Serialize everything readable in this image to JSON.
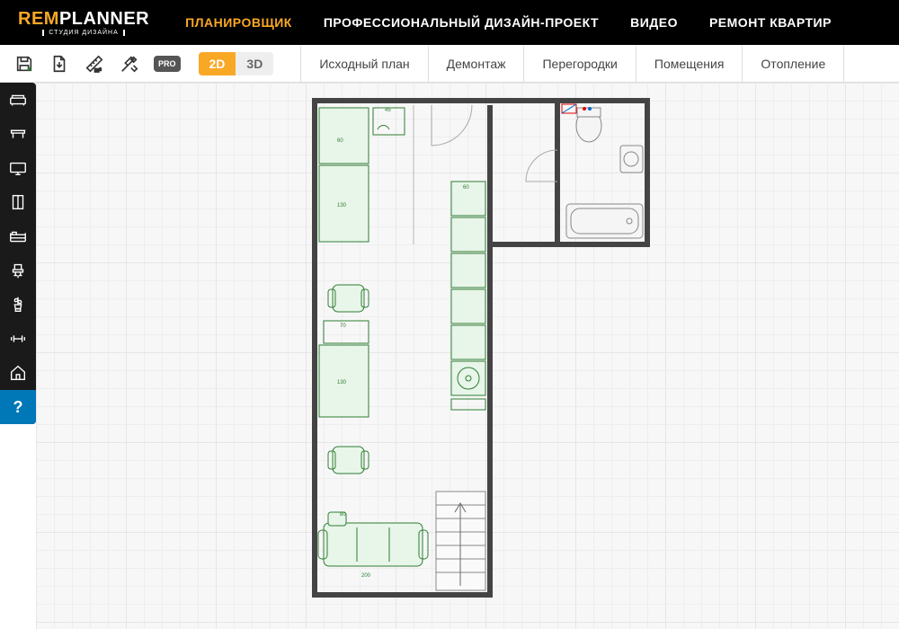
{
  "logo": {
    "rem": "REM",
    "planner": "PLANNER",
    "sub": "СТУДИЯ ДИЗАЙНА"
  },
  "nav": {
    "items": [
      {
        "label": "ПЛАНИРОВЩИК",
        "active": true
      },
      {
        "label": "ПРОФЕССИОНАЛЬНЫЙ ДИЗАЙН-ПРОЕКТ",
        "active": false
      },
      {
        "label": "ВИДЕО",
        "active": false
      },
      {
        "label": "РЕМОНТ КВАРТИР",
        "active": false
      }
    ]
  },
  "toolbar": {
    "pro": "PRO",
    "view2d": "2D",
    "view3d": "3D",
    "tabs": [
      {
        "label": "Исходный план"
      },
      {
        "label": "Демонтаж"
      },
      {
        "label": "Перегородки"
      },
      {
        "label": "Помещения"
      },
      {
        "label": "Отопление"
      }
    ]
  },
  "sidebar": {
    "help": "?"
  },
  "plan": {
    "dims": {
      "bed_w": "130",
      "bed_w2": "60",
      "desk_w": "45",
      "sofa_w": "200",
      "tbl_w": "70",
      "cab_w": "80",
      "cab_w2": "60"
    }
  }
}
